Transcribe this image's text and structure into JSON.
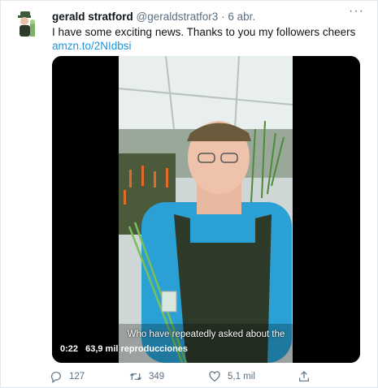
{
  "tweet": {
    "author_name": "gerald stratford",
    "author_handle": "@geraldstratfor3",
    "separator": "·",
    "date": "6 abr.",
    "more_label": "···",
    "text": "I have some exciting news. Thanks to you my followers cheers",
    "link": "amzn.to/2NIdbsi"
  },
  "video": {
    "subtitle": "Who have repeatedly asked about the",
    "time": "0:22",
    "views": "63,9 mil reproducciones"
  },
  "actions": {
    "replies": "127",
    "retweets": "349",
    "likes": "5,1 mil"
  },
  "icons": {
    "reply": "reply-icon",
    "retweet": "retweet-icon",
    "like": "heart-icon",
    "share": "share-icon",
    "more": "more-icon"
  },
  "colors": {
    "link": "#1b95e0",
    "muted": "#5b7083",
    "shirt": "#2aa0d4",
    "apron": "#2e3b2b",
    "cap": "#6b5a3c"
  }
}
